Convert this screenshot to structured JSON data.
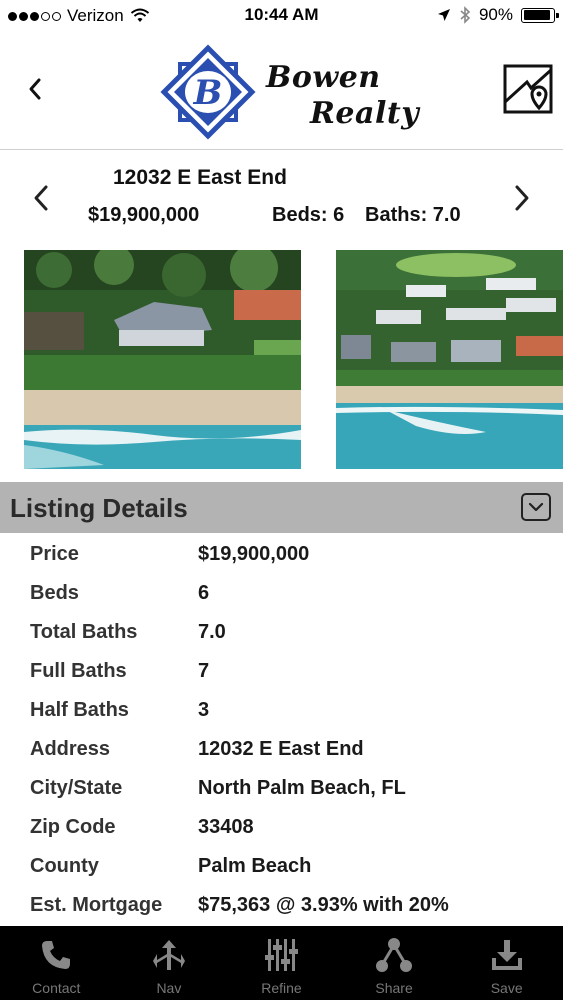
{
  "status_bar": {
    "carrier": "Verizon",
    "time": "10:44 AM",
    "battery_percent": "90%",
    "battery_level": 0.9,
    "signal_bars": 3
  },
  "header": {
    "logo_letter": "B",
    "logo_line1": "Bowen",
    "logo_line2": "Realty",
    "brand_color": "#2a4fb0"
  },
  "listing": {
    "address": "12032 E East End",
    "price": "$19,900,000",
    "beds": "Beds: 6",
    "baths": "Baths: 7.0"
  },
  "details": {
    "title": "Listing Details",
    "rows": [
      {
        "label": "Price",
        "value": "$19,900,000"
      },
      {
        "label": "Beds",
        "value": "6"
      },
      {
        "label": "Total Baths",
        "value": "7.0"
      },
      {
        "label": "Full Baths",
        "value": "7"
      },
      {
        "label": "Half Baths",
        "value": "3"
      },
      {
        "label": "Address",
        "value": "12032 E East End"
      },
      {
        "label": "City/State",
        "value": "North Palm Beach, FL"
      },
      {
        "label": "Zip Code",
        "value": "33408"
      },
      {
        "label": "County",
        "value": "Palm Beach"
      },
      {
        "label": "Est. Mortgage",
        "value": "$75,363 @ 3.93% with 20%"
      }
    ]
  },
  "tabs": [
    {
      "label": "Contact",
      "icon": "phone-icon"
    },
    {
      "label": "Nav",
      "icon": "navigation-icon"
    },
    {
      "label": "Refine",
      "icon": "sliders-icon"
    },
    {
      "label": "Share",
      "icon": "share-icon"
    },
    {
      "label": "Save",
      "icon": "download-icon"
    }
  ]
}
